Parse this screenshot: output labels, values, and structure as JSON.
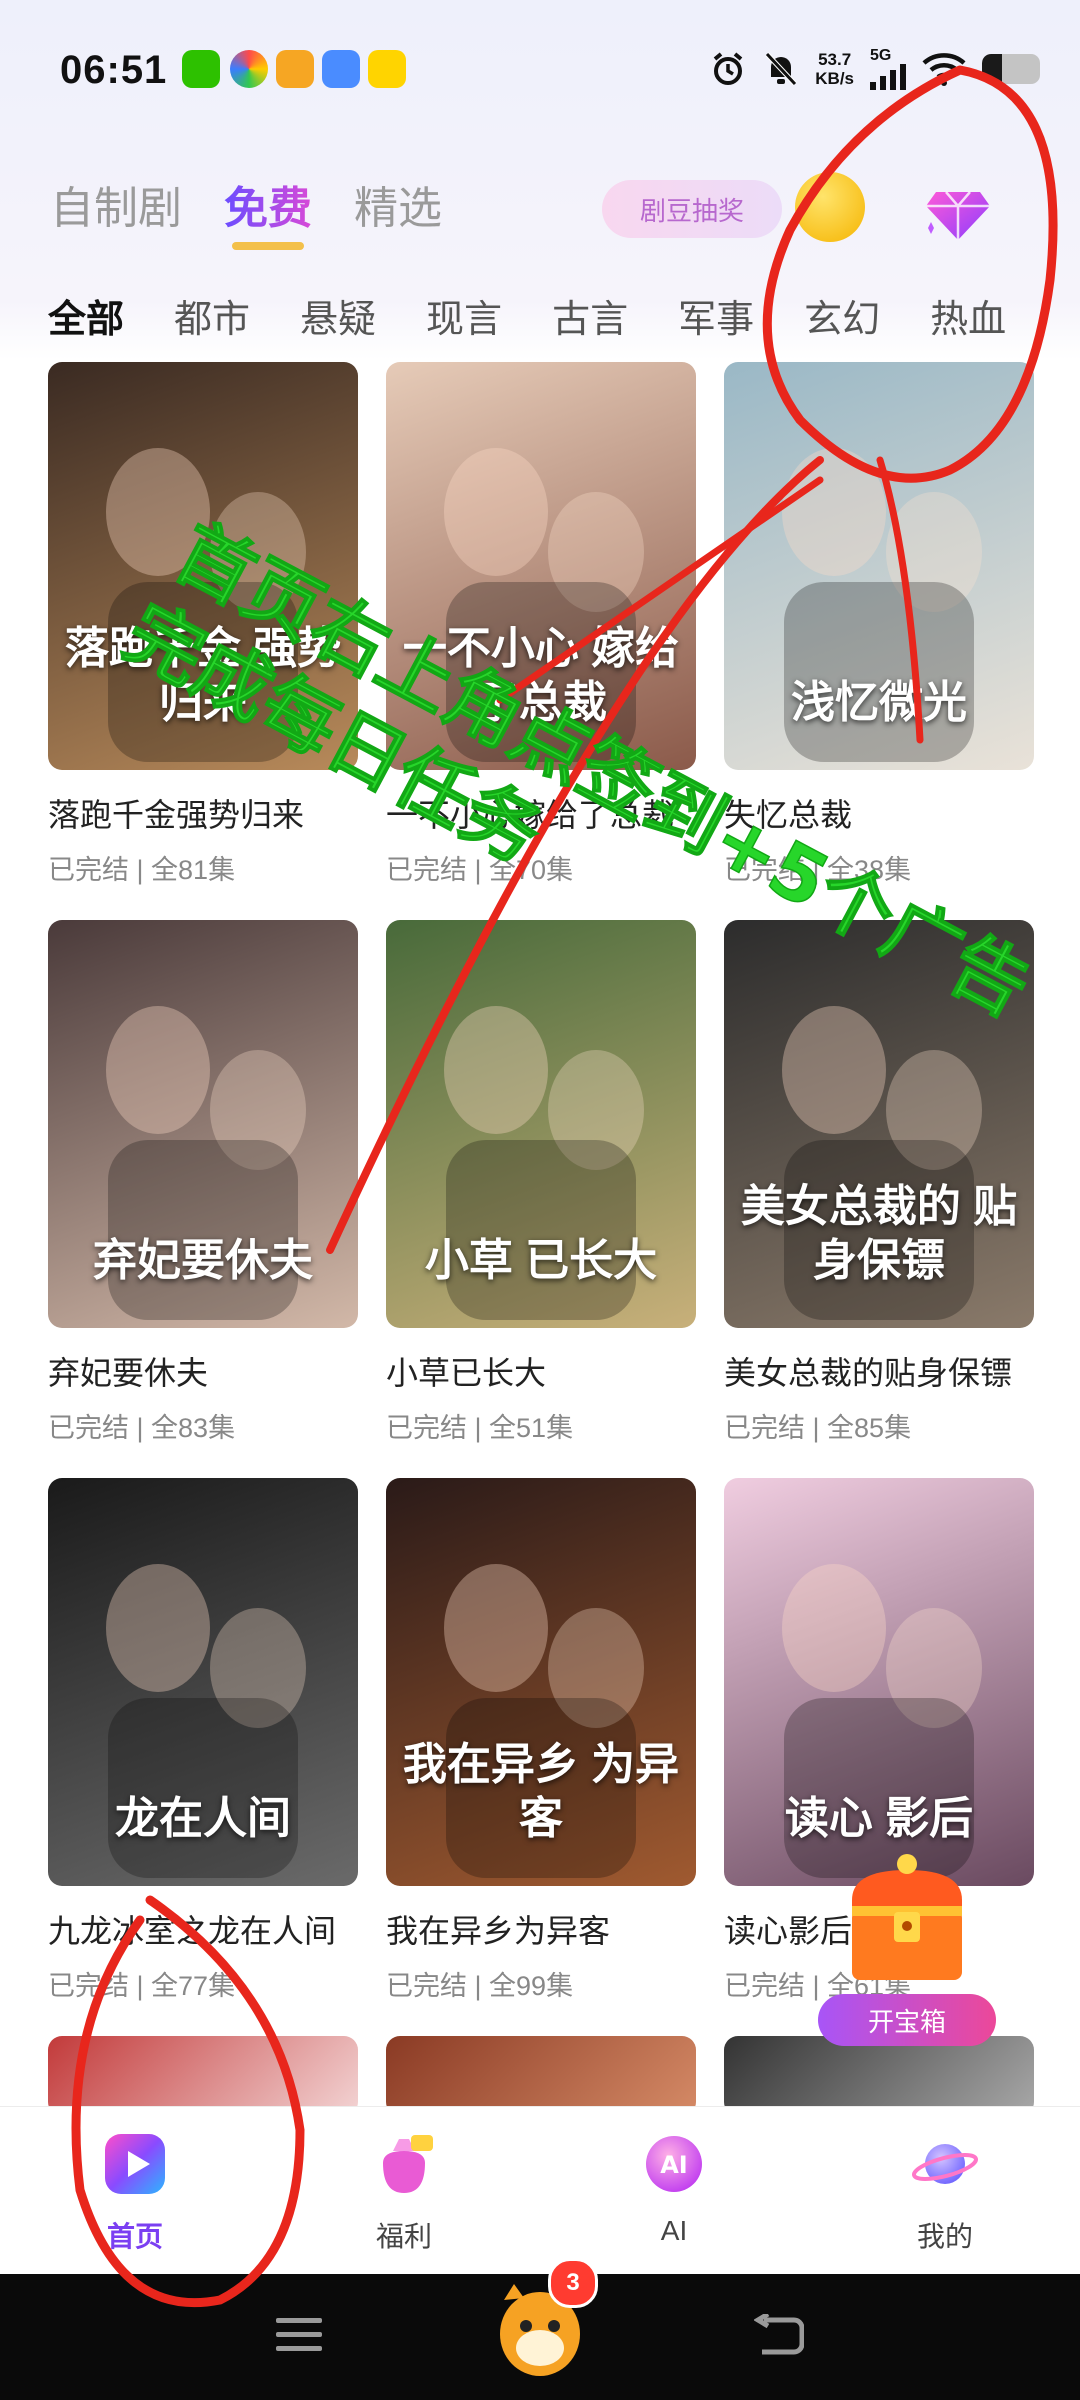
{
  "status_bar": {
    "time": "06:51",
    "net_speed_value": "53.7",
    "net_speed_unit": "KB/s",
    "network": "5G",
    "battery_level": 0.35
  },
  "top_tabs": [
    {
      "label": "自制剧",
      "active": false
    },
    {
      "label": "免费",
      "active": true
    },
    {
      "label": "精选",
      "active": false
    }
  ],
  "lottery_label": "剧豆抽奖",
  "categories": [
    "全部",
    "都市",
    "悬疑",
    "现言",
    "古言",
    "军事",
    "玄幻",
    "热血"
  ],
  "dramas": [
    {
      "title": "落跑千金强势归来",
      "status": "已完结",
      "episodes": "全81集",
      "poster_text": "落跑千金 强势归来"
    },
    {
      "title": "一不小心嫁给了总裁",
      "status": "已完结",
      "episodes": "全70集",
      "poster_text": "一不小心 嫁给了总裁"
    },
    {
      "title": "失忆总裁",
      "status": "已完结",
      "episodes": "全38集",
      "poster_text": "浅忆微光"
    },
    {
      "title": "弃妃要休夫",
      "status": "已完结",
      "episodes": "全83集",
      "poster_text": "弃妃要休夫"
    },
    {
      "title": "小草已长大",
      "status": "已完结",
      "episodes": "全51集",
      "poster_text": "小草 已长大"
    },
    {
      "title": "美女总裁的贴身保镖",
      "status": "已完结",
      "episodes": "全85集",
      "poster_text": "美女总裁的 贴身保镖"
    },
    {
      "title": "九龙冰室之龙在人间",
      "status": "已完结",
      "episodes": "全77集",
      "poster_text": "龙在人间"
    },
    {
      "title": "我在异乡为异客",
      "status": "已完结",
      "episodes": "全99集",
      "poster_text": "我在异乡 为异客"
    },
    {
      "title": "读心影后",
      "status": "已完结",
      "episodes": "全61集",
      "poster_text": "读心 影后"
    }
  ],
  "treasure_label": "开宝箱",
  "bottom_nav": [
    {
      "label": "首页",
      "active": true
    },
    {
      "label": "福利",
      "active": false
    },
    {
      "label": "AI",
      "active": false
    },
    {
      "label": "我的",
      "active": false
    }
  ],
  "system_badge": "3",
  "annotation_text": "首页右上角点签到+5个广告 完成每日任务",
  "colors": {
    "accent": "#7b3ff2",
    "annotation_red": "#e8261c",
    "annotation_green": "#27d62a"
  }
}
